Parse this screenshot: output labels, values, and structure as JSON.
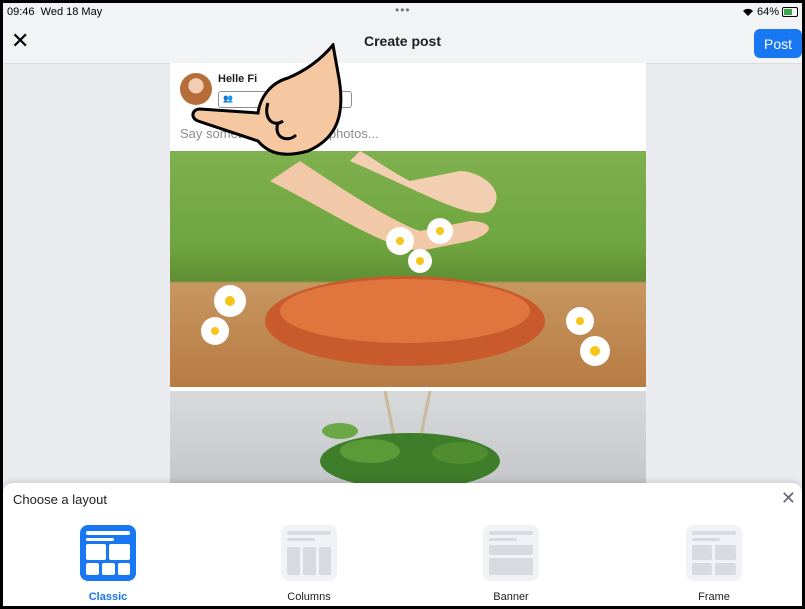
{
  "status_bar": {
    "time": "09:46",
    "date": "Wed 18 May",
    "dots": "•••",
    "battery": "64%",
    "wifi_icon": "wifi-icon"
  },
  "nav": {
    "title": "Create post",
    "post_label": "Post",
    "close_glyph": "✕"
  },
  "composer": {
    "username": "Helle Fi",
    "audience": "",
    "caption_placeholder": "Say something about these photos...",
    "caption_visible_left": "Say somet",
    "caption_visible_right": "these photos..."
  },
  "sheet": {
    "title": "Choose a layout",
    "close_glyph": "✕",
    "layouts": [
      {
        "label": "Classic",
        "selected": true
      },
      {
        "label": "Columns",
        "selected": false
      },
      {
        "label": "Banner",
        "selected": false
      },
      {
        "label": "Frame",
        "selected": false
      }
    ]
  },
  "colors": {
    "accent": "#1877f2",
    "background": "#e9ebee",
    "tile": "#f0f2f5"
  }
}
